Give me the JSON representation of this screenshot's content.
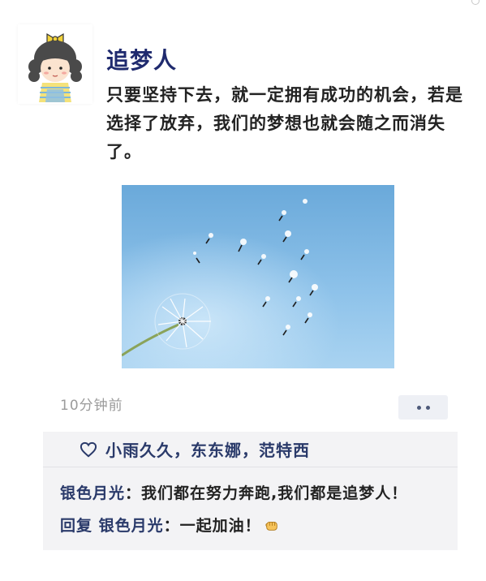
{
  "post": {
    "username": "追梦人",
    "text": "只要坚持下去，就一定拥有成功的机会，若是选择了放弃，我们的梦想也就会随之而消失了。",
    "timestamp": "10分钟前",
    "avatar_icon": "girl-cartoon-avatar",
    "photo_subject": "dandelion-seeds-blue-sky"
  },
  "likes": {
    "icon": "heart-outline-icon",
    "names": "小雨久久，东东娜，范特西"
  },
  "comments": [
    {
      "author": "银色月光",
      "separator": "：",
      "text": "我们都在努力奔跑,我们都是追梦人！"
    },
    {
      "prefix": "回复",
      "author": "银色月光",
      "separator": "：",
      "text": "一起加油！",
      "emoji": "fist-emoji"
    }
  ],
  "colors": {
    "username": "#1f2a6e",
    "link_blue": "#2a3a6a",
    "comment_bg": "#f3f3f5",
    "timestamp": "#9b9b9b"
  }
}
